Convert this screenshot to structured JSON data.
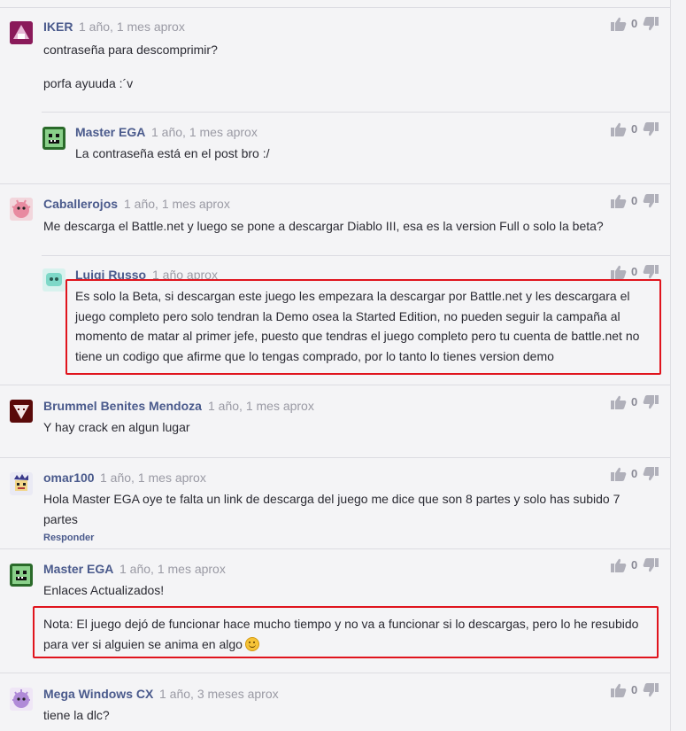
{
  "comments": [
    {
      "author": "IKER",
      "time": "1 año, 1 mes aprox",
      "votes": "0",
      "lines": [
        "contraseña para descomprimir?",
        "porfa ayuuda :´v"
      ]
    },
    {
      "author": "Master EGA",
      "time": "1 año, 1 mes aprox",
      "votes": "0",
      "lines": [
        "La contraseña está en el post bro :/"
      ]
    },
    {
      "author": "Caballerojos",
      "time": "1 año, 1 mes aprox",
      "votes": "0",
      "lines": [
        "Me descarga el Battle.net y luego se pone a descargar Diablo III, esa es la version Full o solo la beta?"
      ]
    },
    {
      "author": "Luigi Russo",
      "time": "1 año aprox",
      "votes": "0",
      "lines": [
        "Es solo la Beta, si descargan este juego les empezara la descargar por Battle.net y les descargara el",
        "juego completo pero solo tendran la Demo osea la Started Edition, no pueden seguir la campaña al",
        "momento de matar al primer jefe, puesto que tendras el juego completo pero tu cuenta de battle.net no",
        "tiene un codigo que afirme que lo tengas comprado, por lo tanto lo tienes version demo"
      ]
    },
    {
      "author": "Brummel Benites Mendoza",
      "time": "1 año, 1 mes aprox",
      "votes": "0",
      "lines": [
        "Y hay crack en algun lugar"
      ]
    },
    {
      "author": "omar100",
      "time": "1 año, 1 mes aprox",
      "votes": "0",
      "lines": [
        "Hola Master EGA oye te falta un link de descarga del juego me dice que son 8 partes y solo has subido 7",
        "partes"
      ],
      "reply_label": "Responder"
    },
    {
      "author": "Master EGA",
      "time": "1 año, 1 mes aprox",
      "votes": "0",
      "lines": [
        "Enlaces Actualizados!",
        "Nota: El juego dejó de funcionar hace mucho tiempo y no va a funcionar si lo descargas, pero lo he resubido",
        "para ver si alguien se anima en algo"
      ]
    },
    {
      "author": "Mega Windows CX",
      "time": "1 año, 3 meses aprox",
      "votes": "0",
      "lines": [
        "tiene la dlc?"
      ]
    }
  ],
  "icons": {
    "upvote": "thumbs-up-icon",
    "downvote": "thumbs-down-icon",
    "emoji": "smiley-emoji-icon"
  },
  "colors": {
    "author": "#4a5a8c",
    "highlight": "#e0141d",
    "timestamp": "#9a9aa4"
  }
}
